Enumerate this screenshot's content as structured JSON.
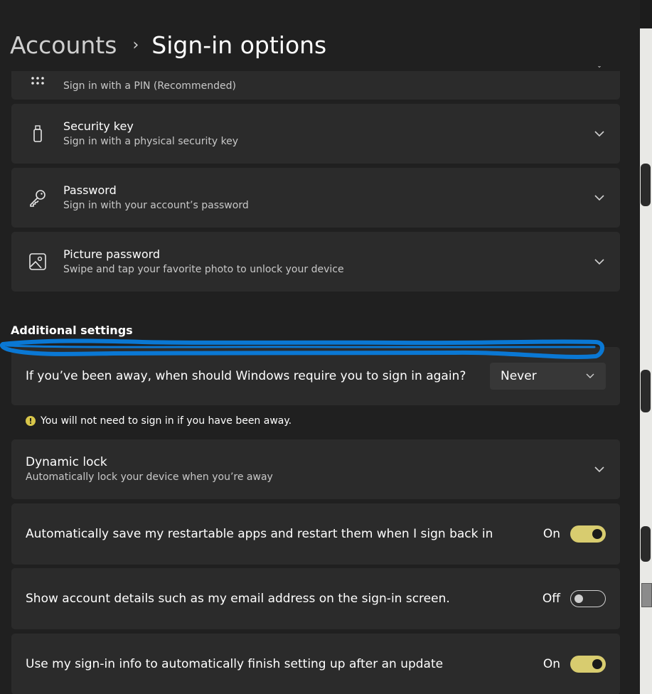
{
  "breadcrumb": {
    "parent": "Accounts",
    "separator": "›",
    "current": "Sign-in options"
  },
  "sign_in_options": [
    {
      "icon": "pin-keypad-icon",
      "title": "",
      "subtitle": "Sign in with a PIN (Recommended)"
    },
    {
      "icon": "security-key-icon",
      "title": "Security key",
      "subtitle": "Sign in with a physical security key"
    },
    {
      "icon": "key-icon",
      "title": "Password",
      "subtitle": "Sign in with your account’s password"
    },
    {
      "icon": "picture-icon",
      "title": "Picture password",
      "subtitle": "Swipe and tap your favorite photo to unlock your device"
    }
  ],
  "additional_settings": {
    "heading": "Additional settings",
    "require_sign_in": {
      "label": "If you’ve been away, when should Windows require you to sign in again?",
      "selected": "Never"
    },
    "info_message": "You will not need to sign in if you have been away.",
    "info_icon": "!",
    "dynamic_lock": {
      "title": "Dynamic lock",
      "subtitle": "Automatically lock your device when you’re away"
    },
    "toggles": [
      {
        "label": "Automatically save my restartable apps and restart them when I sign back in",
        "state_text": "On",
        "on": true
      },
      {
        "label": "Show account details such as my email address on the sign-in screen.",
        "state_text": "Off",
        "on": false
      },
      {
        "label": "Use my sign-in info to automatically finish setting up after an update",
        "state_text": "On",
        "on": true
      }
    ]
  },
  "colors": {
    "background": "#202020",
    "card": "#2b2b2b",
    "toggle_on": "#d8cc6f",
    "annotation_stroke": "#0a78d4",
    "warning": "#d8c64a"
  }
}
